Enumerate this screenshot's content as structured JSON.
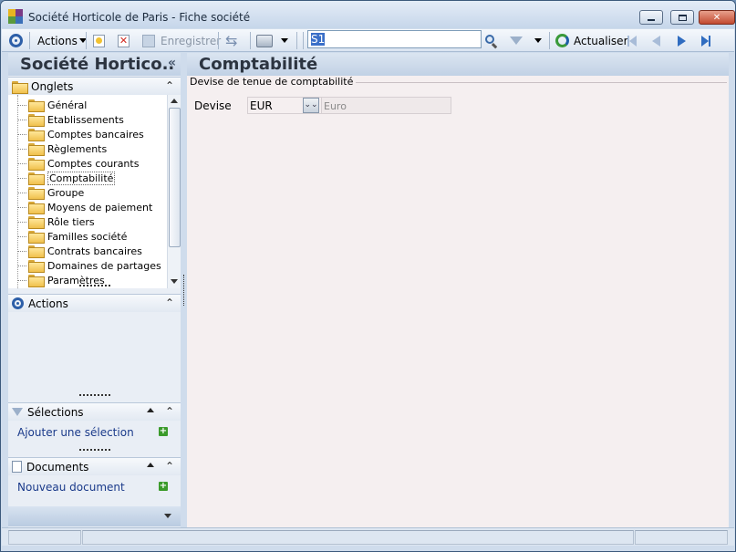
{
  "window": {
    "title": "Société Horticole de Paris -  Fiche société",
    "minimize_icon": "minimize-icon",
    "maximize_icon": "maximize-icon",
    "close_icon": "close-icon"
  },
  "toolbar": {
    "actions_label": "Actions",
    "save_label": "Enregistrer",
    "search_value": "S1",
    "refresh_label": "Actualiser"
  },
  "left": {
    "header": "Société Hortico..",
    "collapse_glyph": "«",
    "onglets": {
      "title": "Onglets",
      "items": [
        {
          "label": "Général"
        },
        {
          "label": "Etablissements"
        },
        {
          "label": "Comptes bancaires"
        },
        {
          "label": "Règlements"
        },
        {
          "label": "Comptes courants"
        },
        {
          "label": "Comptabilité"
        },
        {
          "label": "Groupe"
        },
        {
          "label": "Moyens de paiement"
        },
        {
          "label": "Rôle tiers"
        },
        {
          "label": "Familles société"
        },
        {
          "label": "Contrats bancaires"
        },
        {
          "label": "Domaines de partages"
        },
        {
          "label": "Paramètres"
        }
      ],
      "selected_index": 5
    },
    "actions": {
      "title": "Actions"
    },
    "selections": {
      "title": "Sélections",
      "link": "Ajouter une sélection"
    },
    "documents": {
      "title": "Documents",
      "link": "Nouveau document"
    }
  },
  "main": {
    "title": "Comptabilité",
    "group_title": "Devise de tenue de comptabilité",
    "devise": {
      "label": "Devise",
      "code": "EUR",
      "libelle": "Euro"
    }
  },
  "colors": {
    "accent_blue": "#2d5fa8",
    "link_blue": "#1a3a8a",
    "plus_green": "#3a9a2a",
    "main_bg": "#f5eff0"
  }
}
